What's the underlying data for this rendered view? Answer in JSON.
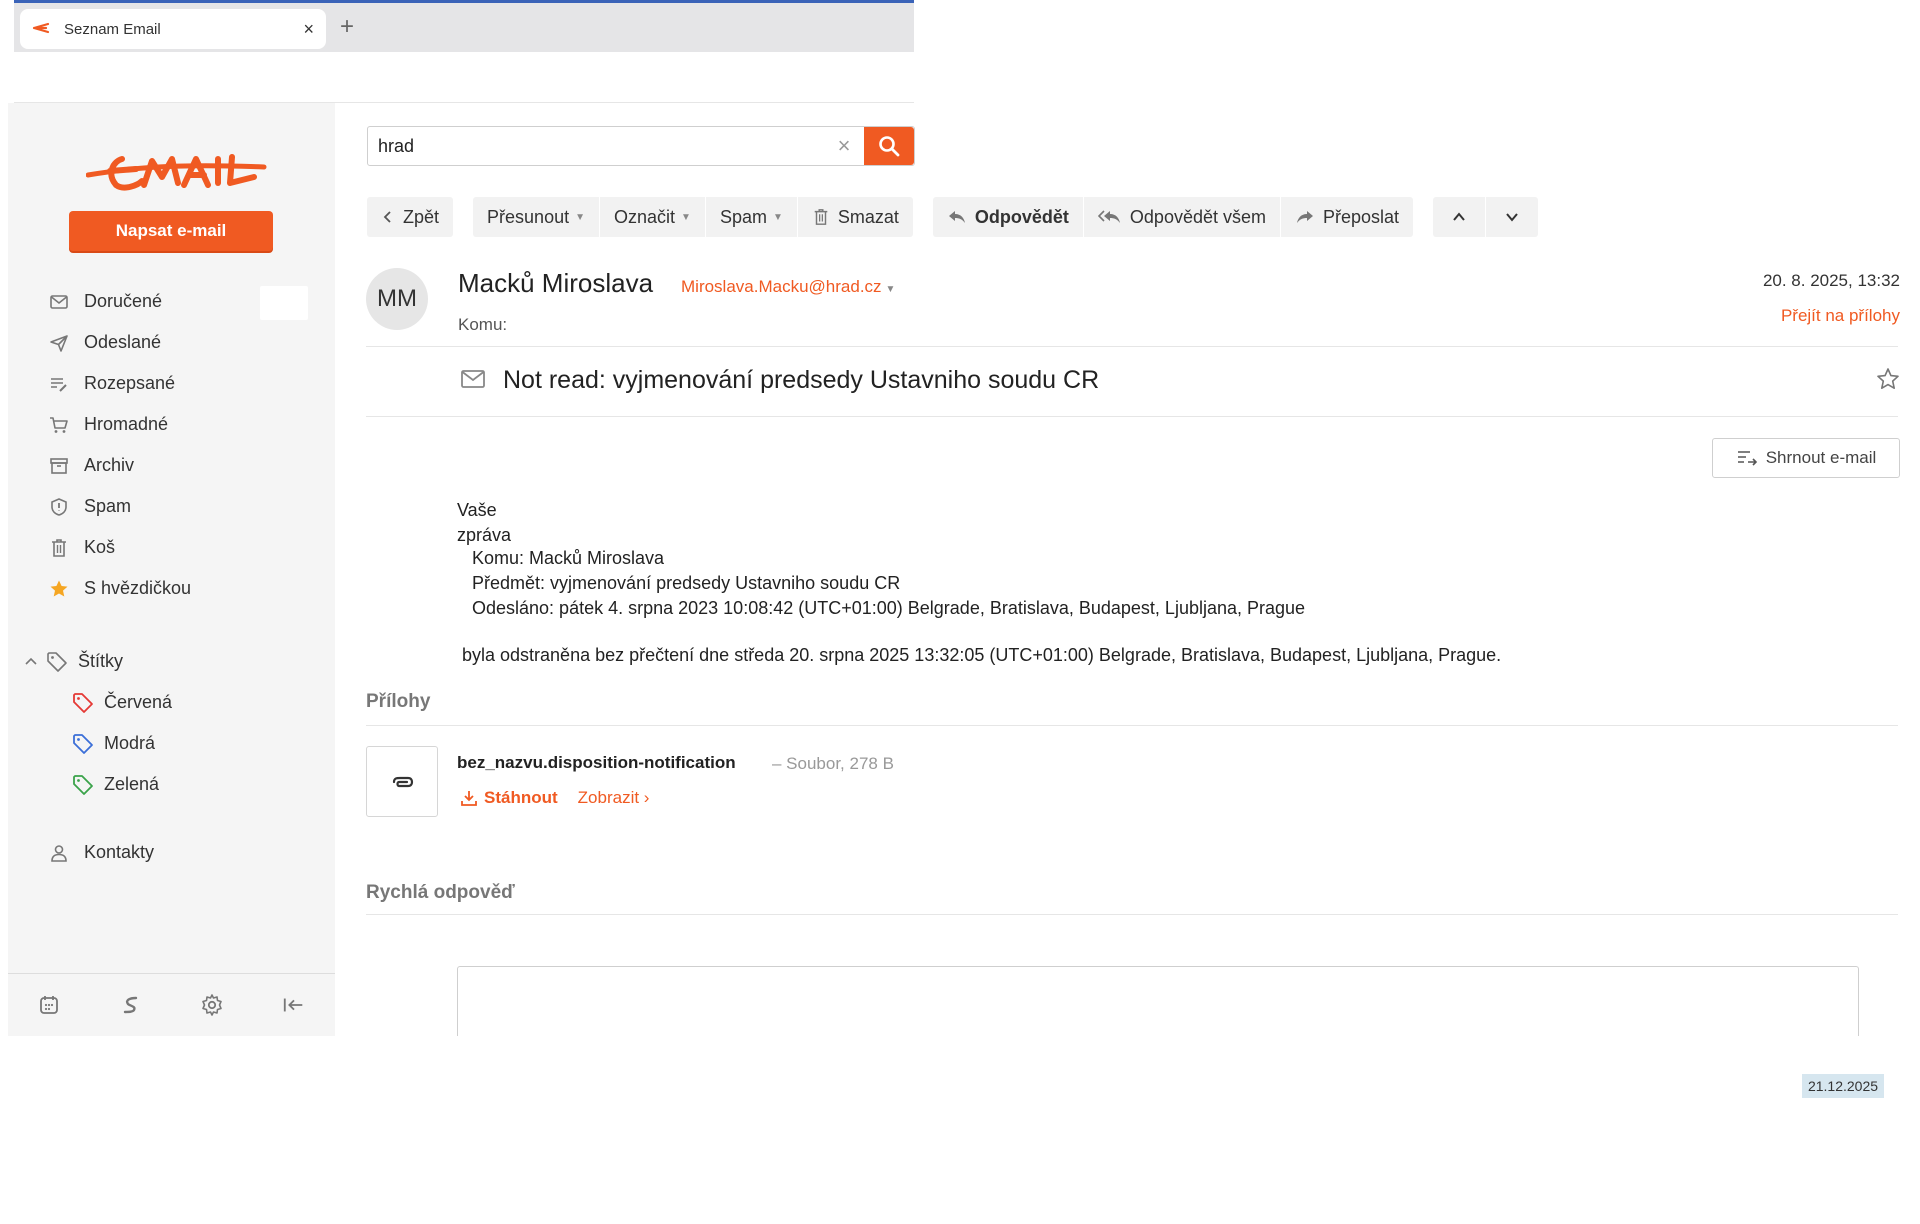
{
  "browser": {
    "tab_title": "Seznam Email",
    "tab_close": "×",
    "new_tab": "+"
  },
  "sidebar": {
    "logo_text": "EMAIL",
    "compose_label": "Napsat e-mail",
    "items": [
      {
        "label": "Doručené",
        "icon": "inbox-icon"
      },
      {
        "label": "Odeslané",
        "icon": "send-icon"
      },
      {
        "label": "Rozepsané",
        "icon": "draft-icon"
      },
      {
        "label": "Hromadné",
        "icon": "cart-icon"
      },
      {
        "label": "Archiv",
        "icon": "archive-icon"
      },
      {
        "label": "Spam",
        "icon": "shield-icon"
      },
      {
        "label": "Koš",
        "icon": "trash-icon"
      },
      {
        "label": "S hvězdičkou",
        "icon": "star-icon"
      }
    ],
    "labels_header": "Štítky",
    "labels": [
      {
        "label": "Červená",
        "color": "#e53935"
      },
      {
        "label": "Modrá",
        "color": "#3b6fd8"
      },
      {
        "label": "Zelená",
        "color": "#3aa34a"
      }
    ],
    "contacts_label": "Kontakty"
  },
  "search": {
    "value": "hrad",
    "clear": "×"
  },
  "toolbar": {
    "back": "Zpět",
    "move": "Přesunout",
    "mark": "Označit",
    "spam": "Spam",
    "delete": "Smazat",
    "reply": "Odpovědět",
    "reply_all": "Odpovědět všem",
    "forward": "Přeposlat"
  },
  "message": {
    "avatar_initials": "MM",
    "sender_name": "Macků Miroslava",
    "sender_email": "Miroslava.Macku@hrad.cz",
    "to_label": "Komu:",
    "date": "20. 8. 2025, 13:32",
    "goto_attachments": "Přejít na přílohy",
    "subject": "Not read: vyjmenování predsedy Ustavniho soudu CR",
    "summarize": "Shrnout e-mail",
    "body_greeting": "Vaše zpráva",
    "body_to": "Komu: Macků Miroslava",
    "body_subject": "Předmět: vyjmenování predsedy Ustavniho soudu CR",
    "body_sent": "Odesláno: pátek 4. srpna 2023 10:08:42 (UTC+01:00) Belgrade, Bratislava, Budapest, Ljubljana, Prague",
    "body_final": "byla odstraněna bez přečtení dne středa 20. srpna 2025 13:32:05 (UTC+01:00) Belgrade, Bratislava, Budapest, Ljubljana, Prague."
  },
  "attachments": {
    "title": "Přílohy",
    "file_name": "bez_nazvu.disposition-notification",
    "file_meta": "– Soubor, 278 B",
    "download": "Stáhnout",
    "view": "Zobrazit ›"
  },
  "quick_reply": {
    "title": "Rychlá odpověď"
  },
  "taskbar": {
    "date": "21.12.2025"
  },
  "colors": {
    "accent": "#f05a22"
  }
}
